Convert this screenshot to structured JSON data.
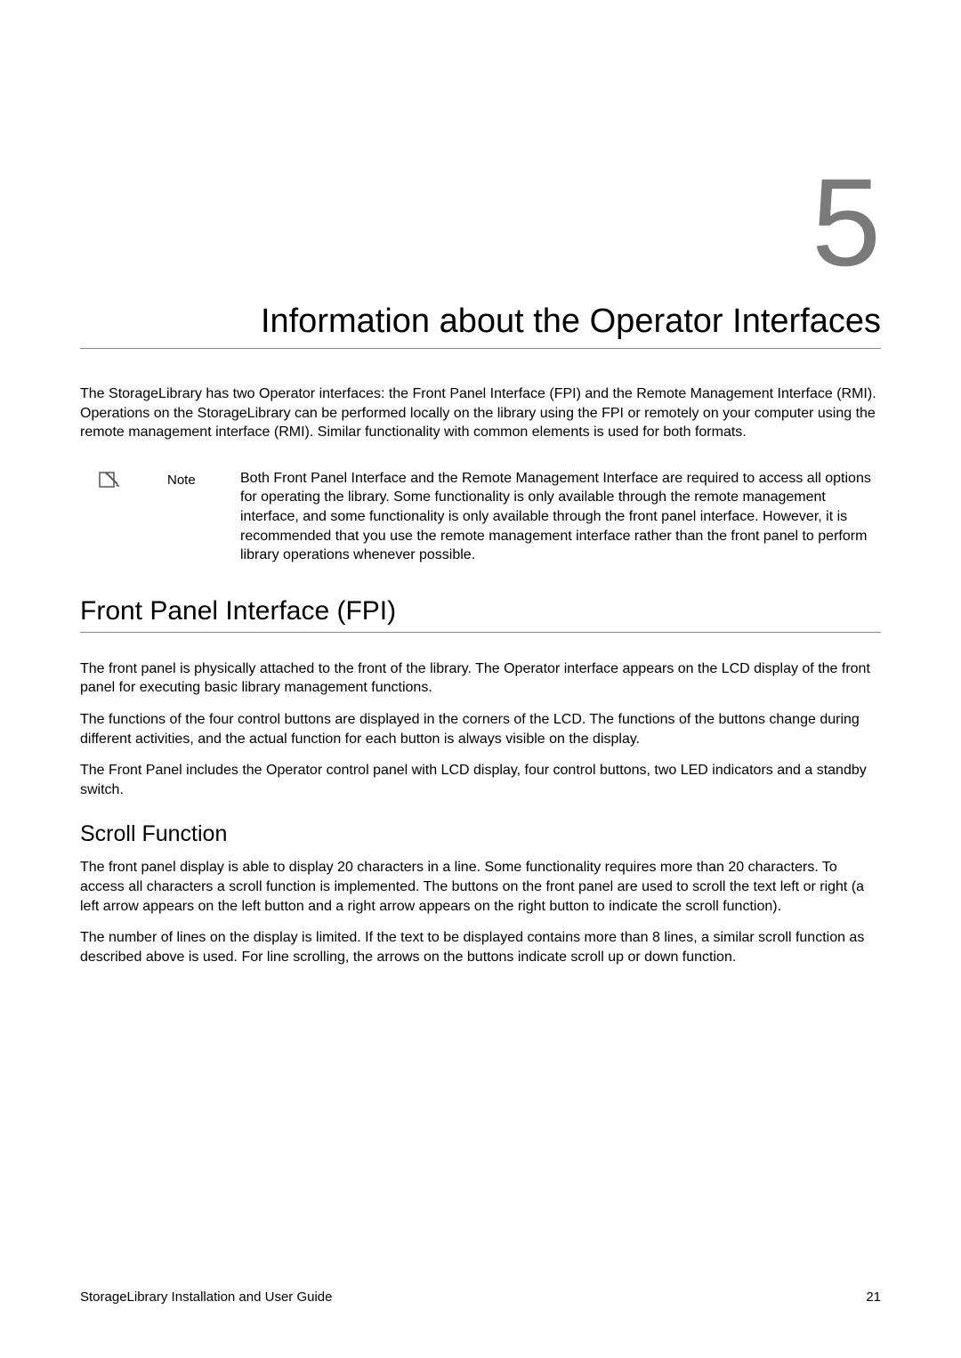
{
  "chapter": {
    "number": "5",
    "title": "Information about the Operator Interfaces"
  },
  "intro": "The StorageLibrary has two Operator interfaces: the Front Panel Interface (FPI) and the Remote Management Interface (RMI). Operations on the StorageLibrary can be performed locally on the library using the FPI or remotely on your computer using the remote management interface (RMI). Similar functionality with common elements is used for both formats.",
  "note": {
    "label": "Note",
    "text": "Both Front Panel Interface and the Remote Management Interface are required to access all options for operating the library. Some functionality is only available through the remote management interface, and some functionality is only available through the front panel interface. However, it is recommended that you use the remote management interface rather than the front panel to perform library operations whenever possible."
  },
  "section1": {
    "title": "Front Panel Interface (FPI)",
    "para1": "The front panel is physically attached to the front of the library. The Operator interface appears on the LCD display of the front panel for executing basic library management functions.",
    "para2": "The functions of the four control buttons are displayed in the corners of the LCD. The functions of the buttons change during different activities, and the actual function for each button is always visible on the display.",
    "para3": "The Front Panel includes the Operator control panel with LCD display, four control buttons, two LED indicators and a standby switch."
  },
  "section2": {
    "title": "Scroll Function",
    "para1": "The front panel display is able to display 20 characters in a line. Some functionality requires more than 20 characters. To access all characters a scroll function is implemented. The buttons on the front panel are used to scroll the text left or right (a left arrow appears on the left button and a right arrow appears on the right button to indicate the scroll function).",
    "para2": "The number of lines on the display is limited. If the text to be displayed contains more than 8 lines, a similar scroll function as described above is used. For line scrolling, the arrows on the buttons indicate scroll up or down function."
  },
  "footer": {
    "left": "StorageLibrary Installation and User Guide",
    "right": "21"
  }
}
